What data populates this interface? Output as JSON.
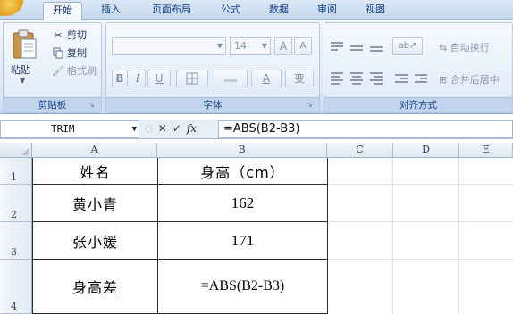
{
  "ribbon": {
    "tabs": [
      {
        "label": "开始",
        "active": true
      },
      {
        "label": "插入",
        "active": false
      },
      {
        "label": "页面布局",
        "active": false
      },
      {
        "label": "公式",
        "active": false
      },
      {
        "label": "数据",
        "active": false
      },
      {
        "label": "审阅",
        "active": false
      },
      {
        "label": "视图",
        "active": false
      }
    ],
    "clipboard": {
      "paste_label": "粘贴",
      "cut_label": "剪切",
      "copy_label": "复制",
      "format_painter_label": "格式刷",
      "group_label": "剪贴板"
    },
    "font": {
      "font_name": "",
      "font_size": "14",
      "grow_label": "A",
      "shrink_label": "A",
      "bold_label": "B",
      "italic_label": "I",
      "underline_label": "U",
      "phonetic_label": "变",
      "font_color_label": "A",
      "group_label": "字体"
    },
    "alignment": {
      "wrap_text_label": "自动换行",
      "merge_center_label": "合并后居中",
      "group_label": "对齐方式"
    }
  },
  "formula_bar": {
    "name_box": "TRIM",
    "fx_label": "fx",
    "formula": "=ABS(B2-B3)"
  },
  "sheet": {
    "columns": [
      "A",
      "B",
      "C",
      "D",
      "E"
    ],
    "rows": [
      "1",
      "2",
      "3",
      "4"
    ],
    "cells": {
      "A1": "姓名",
      "B1": "身高（cm）",
      "A2": "黄小青",
      "B2": "162",
      "A3": "张小媛",
      "B3": "171",
      "A4": "身高差",
      "B4": "=ABS(B2-B3)"
    }
  }
}
